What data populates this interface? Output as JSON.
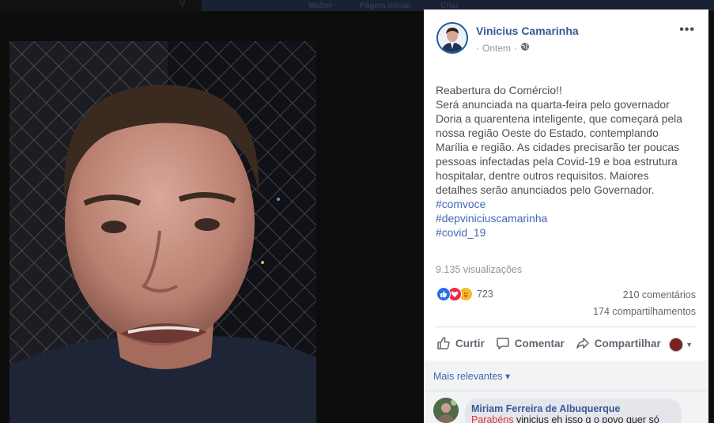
{
  "topbar": {
    "nav_items": [
      "Walter",
      "Página inicial",
      "Criar"
    ]
  },
  "post": {
    "author": "Vinicius Camarinha",
    "time": "Ontem",
    "privacy_icon": "globe-icon",
    "more_label": "•••",
    "body_lines": [
      "Reabertura do Comércio!!",
      "Será anunciada na quarta-feira pelo governador",
      "Doria a quarentena inteligente, que começará pela",
      "nossa região Oeste do Estado, contemplando",
      "Marília e região. As cidades precisarão ter poucas",
      "pessoas infectadas pela Covid-19 e boa estrutura",
      "hospitalar, dentre outros requisitos. Maiores",
      "detalhes serão anunciados pelo Governador."
    ],
    "hashtags": [
      "#comvoce",
      "#depviniciuscamarinha",
      "#covid_19"
    ],
    "views": "9.135 visualizações",
    "reaction_count": "723",
    "comments_count": "210 comentários",
    "shares_count": "174 compartilhamentos"
  },
  "actions": {
    "like": "Curtir",
    "comment": "Comentar",
    "share": "Compartilhar"
  },
  "comments": {
    "sort_label": "Mais relevantes ▾",
    "first": {
      "author": "Miriam Ferreira de Albuquerque",
      "text_highlight": "Parabéns",
      "text_rest": " vinicius eh isso q o povo quer só"
    }
  },
  "colors": {
    "link": "#4267b2",
    "author": "#365899",
    "muted": "#90949c"
  }
}
